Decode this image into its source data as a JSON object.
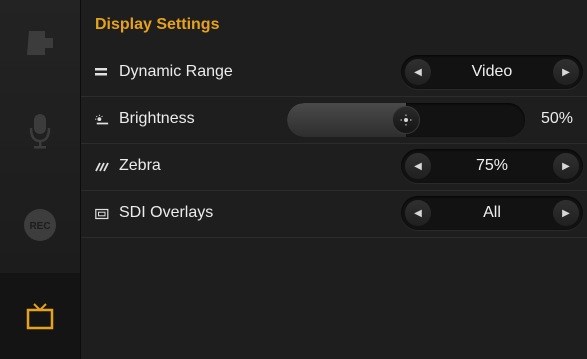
{
  "sidebar": {
    "tabs": [
      {
        "icon": "camera-icon"
      },
      {
        "icon": "microphone-icon"
      },
      {
        "icon": "rec-icon",
        "label": "REC"
      },
      {
        "icon": "monitor-icon",
        "active": true
      }
    ]
  },
  "page": {
    "title": "Display Settings"
  },
  "rows": [
    {
      "label": "Dynamic Range",
      "icon": "dynamic-range-icon",
      "value": "Video"
    },
    {
      "label": "Brightness",
      "icon": "brightness-icon",
      "value": "50%",
      "level": 0.5
    },
    {
      "label": "Zebra",
      "icon": "zebra-icon",
      "value": "75%"
    },
    {
      "label": "SDI Overlays",
      "icon": "sdi-overlays-icon",
      "value": "All"
    }
  ],
  "colors": {
    "accent": "#e7a21b",
    "background": "#1e1e1e"
  }
}
